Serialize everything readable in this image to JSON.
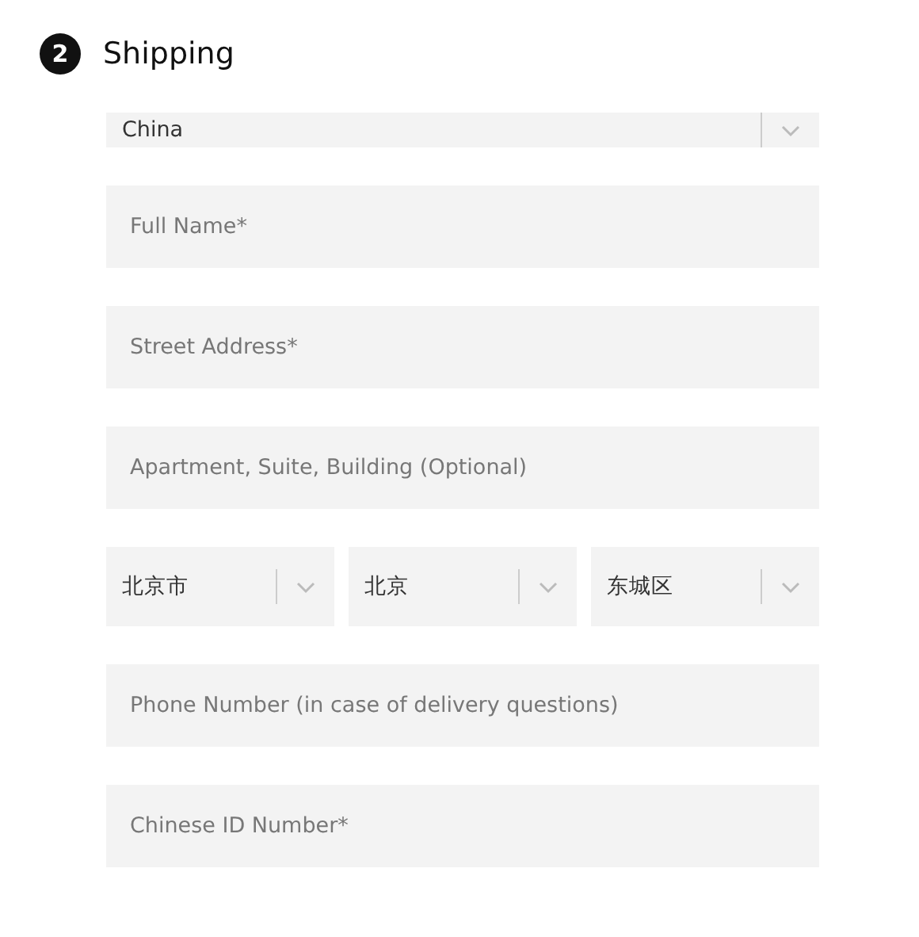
{
  "section": {
    "step": "2",
    "title": "Shipping"
  },
  "fields": [
    {
      "kind": "select",
      "value": "China"
    },
    {
      "kind": "input",
      "placeholder": "Full Name*"
    },
    {
      "kind": "input",
      "placeholder": "Street Address*"
    },
    {
      "kind": "input",
      "placeholder": "Apartment, Suite, Building (Optional)"
    },
    {
      "kind": "select-row",
      "selects": [
        {
          "value": "北京市"
        },
        {
          "value": "北京"
        },
        {
          "value": "东城区"
        }
      ]
    },
    {
      "kind": "input",
      "placeholder": "Phone Number (in case of delivery questions)"
    },
    {
      "kind": "input",
      "placeholder": "Chinese ID Number*"
    }
  ]
}
